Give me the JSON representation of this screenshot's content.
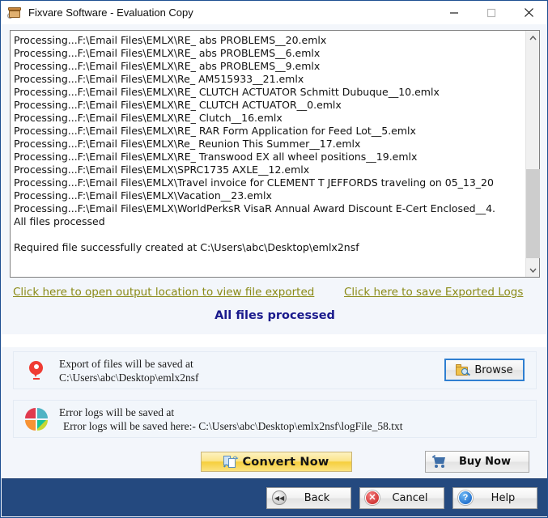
{
  "window": {
    "title": "Fixvare Software - Evaluation Copy",
    "icon": "archive-box-icon",
    "minimize_label": "—",
    "maximize_label": "□",
    "close_label": "✕"
  },
  "log": {
    "lines": [
      "Processing...F:\\Email Files\\EMLX\\RE_ abs PROBLEMS__20.emlx",
      "Processing...F:\\Email Files\\EMLX\\RE_ abs PROBLEMS__6.emlx",
      "Processing...F:\\Email Files\\EMLX\\RE_ abs PROBLEMS__9.emlx",
      "Processing...F:\\Email Files\\EMLX\\Re_ AM515933__21.emlx",
      "Processing...F:\\Email Files\\EMLX\\RE_ CLUTCH ACTUATOR Schmitt Dubuque__10.emlx",
      "Processing...F:\\Email Files\\EMLX\\RE_ CLUTCH ACTUATOR__0.emlx",
      "Processing...F:\\Email Files\\EMLX\\RE_ Clutch__16.emlx",
      "Processing...F:\\Email Files\\EMLX\\RE_ RAR Form Application for Feed Lot__5.emlx",
      "Processing...F:\\Email Files\\EMLX\\Re_ Reunion This Summer__17.emlx",
      "Processing...F:\\Email Files\\EMLX\\RE_ Transwood EX all wheel positions__19.emlx",
      "Processing...F:\\Email Files\\EMLX\\SPRC1735 AXLE__12.emlx",
      "Processing...F:\\Email Files\\EMLX\\Travel invoice for CLEMENT T JEFFORDS traveling on 05_13_20",
      "Processing...F:\\Email Files\\EMLX\\Vacation__23.emlx",
      "Processing...F:\\Email Files\\EMLX\\WorldPerksR VisaR Annual Award Discount E-Cert Enclosed__4.",
      "All files processed",
      "",
      "Required file successfully created at C:\\Users\\abc\\Desktop\\emlx2nsf"
    ]
  },
  "links": {
    "open_output": "Click here to open output location to view file exported",
    "save_logs": "Click here to save Exported Logs",
    "color": "#8a8a16"
  },
  "status": {
    "text": "All files processed",
    "color": "#1a1a8c"
  },
  "export_panel": {
    "icon": "location-pin-icon",
    "line1": "Export of files will be saved at",
    "line2": "C:\\Users\\abc\\Desktop\\emlx2nsf",
    "browse_label": "Browse",
    "browse_icon": "folder-search-icon"
  },
  "logs_panel": {
    "icon": "pie-chart-icon",
    "line1": "Error logs will be saved at",
    "line2": "Error logs will be saved here:- C:\\Users\\abc\\Desktop\\emlx2nsf\\logFile_58.txt"
  },
  "actions": {
    "convert_label": "Convert Now",
    "convert_icon": "convert-documents-icon",
    "buy_label": "Buy Now",
    "buy_icon": "shopping-cart-icon"
  },
  "navigation": {
    "back_label": "Back",
    "back_icon": "rewind-icon",
    "cancel_label": "Cancel",
    "cancel_icon": "error-cross-icon",
    "help_label": "Help",
    "help_icon": "question-mark-icon"
  }
}
